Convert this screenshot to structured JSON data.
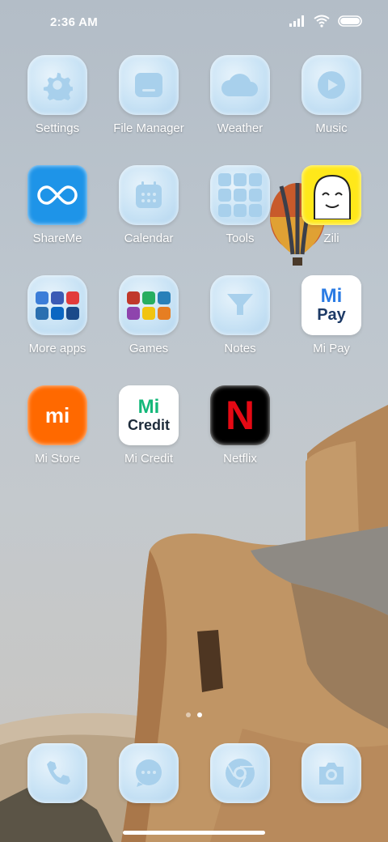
{
  "status_bar": {
    "time": "2:36 AM"
  },
  "apps": [
    {
      "id": "settings",
      "label": "Settings",
      "icon": "gear-icon"
    },
    {
      "id": "file-manager",
      "label": "File Manager",
      "icon": "folder-icon"
    },
    {
      "id": "weather",
      "label": "Weather",
      "icon": "cloud-icon"
    },
    {
      "id": "music",
      "label": "Music",
      "icon": "play-icon"
    },
    {
      "id": "shareme",
      "label": "ShareMe",
      "icon": "infinity-icon"
    },
    {
      "id": "calendar",
      "label": "Calendar",
      "icon": "calendar-icon"
    },
    {
      "id": "tools",
      "label": "Tools",
      "icon": "tools-folder-icon"
    },
    {
      "id": "zili",
      "label": "Zili",
      "icon": "zili-face-icon"
    },
    {
      "id": "more-apps",
      "label": "More apps",
      "icon": "apps-folder-icon"
    },
    {
      "id": "games",
      "label": "Games",
      "icon": "games-folder-icon"
    },
    {
      "id": "notes",
      "label": "Notes",
      "icon": "notes-icon"
    },
    {
      "id": "mi-pay",
      "label": "Mi Pay",
      "icon": "mi-pay-icon",
      "logo_text": [
        "Mi",
        "Pay"
      ]
    },
    {
      "id": "mi-store",
      "label": "Mi Store",
      "icon": "mi-logo-icon",
      "logo_text": "mi"
    },
    {
      "id": "mi-credit",
      "label": "Mi Credit",
      "icon": "mi-credit-icon",
      "logo_text": [
        "Mi",
        "Credit"
      ]
    },
    {
      "id": "netflix",
      "label": "Netflix",
      "icon": "netflix-icon",
      "logo_text": "N"
    }
  ],
  "dock": [
    {
      "id": "phone",
      "icon": "phone-icon"
    },
    {
      "id": "messages",
      "icon": "message-icon"
    },
    {
      "id": "browser",
      "icon": "chrome-icon"
    },
    {
      "id": "camera",
      "icon": "camera-icon"
    }
  ],
  "pager": {
    "pages": 2,
    "active": 2
  }
}
